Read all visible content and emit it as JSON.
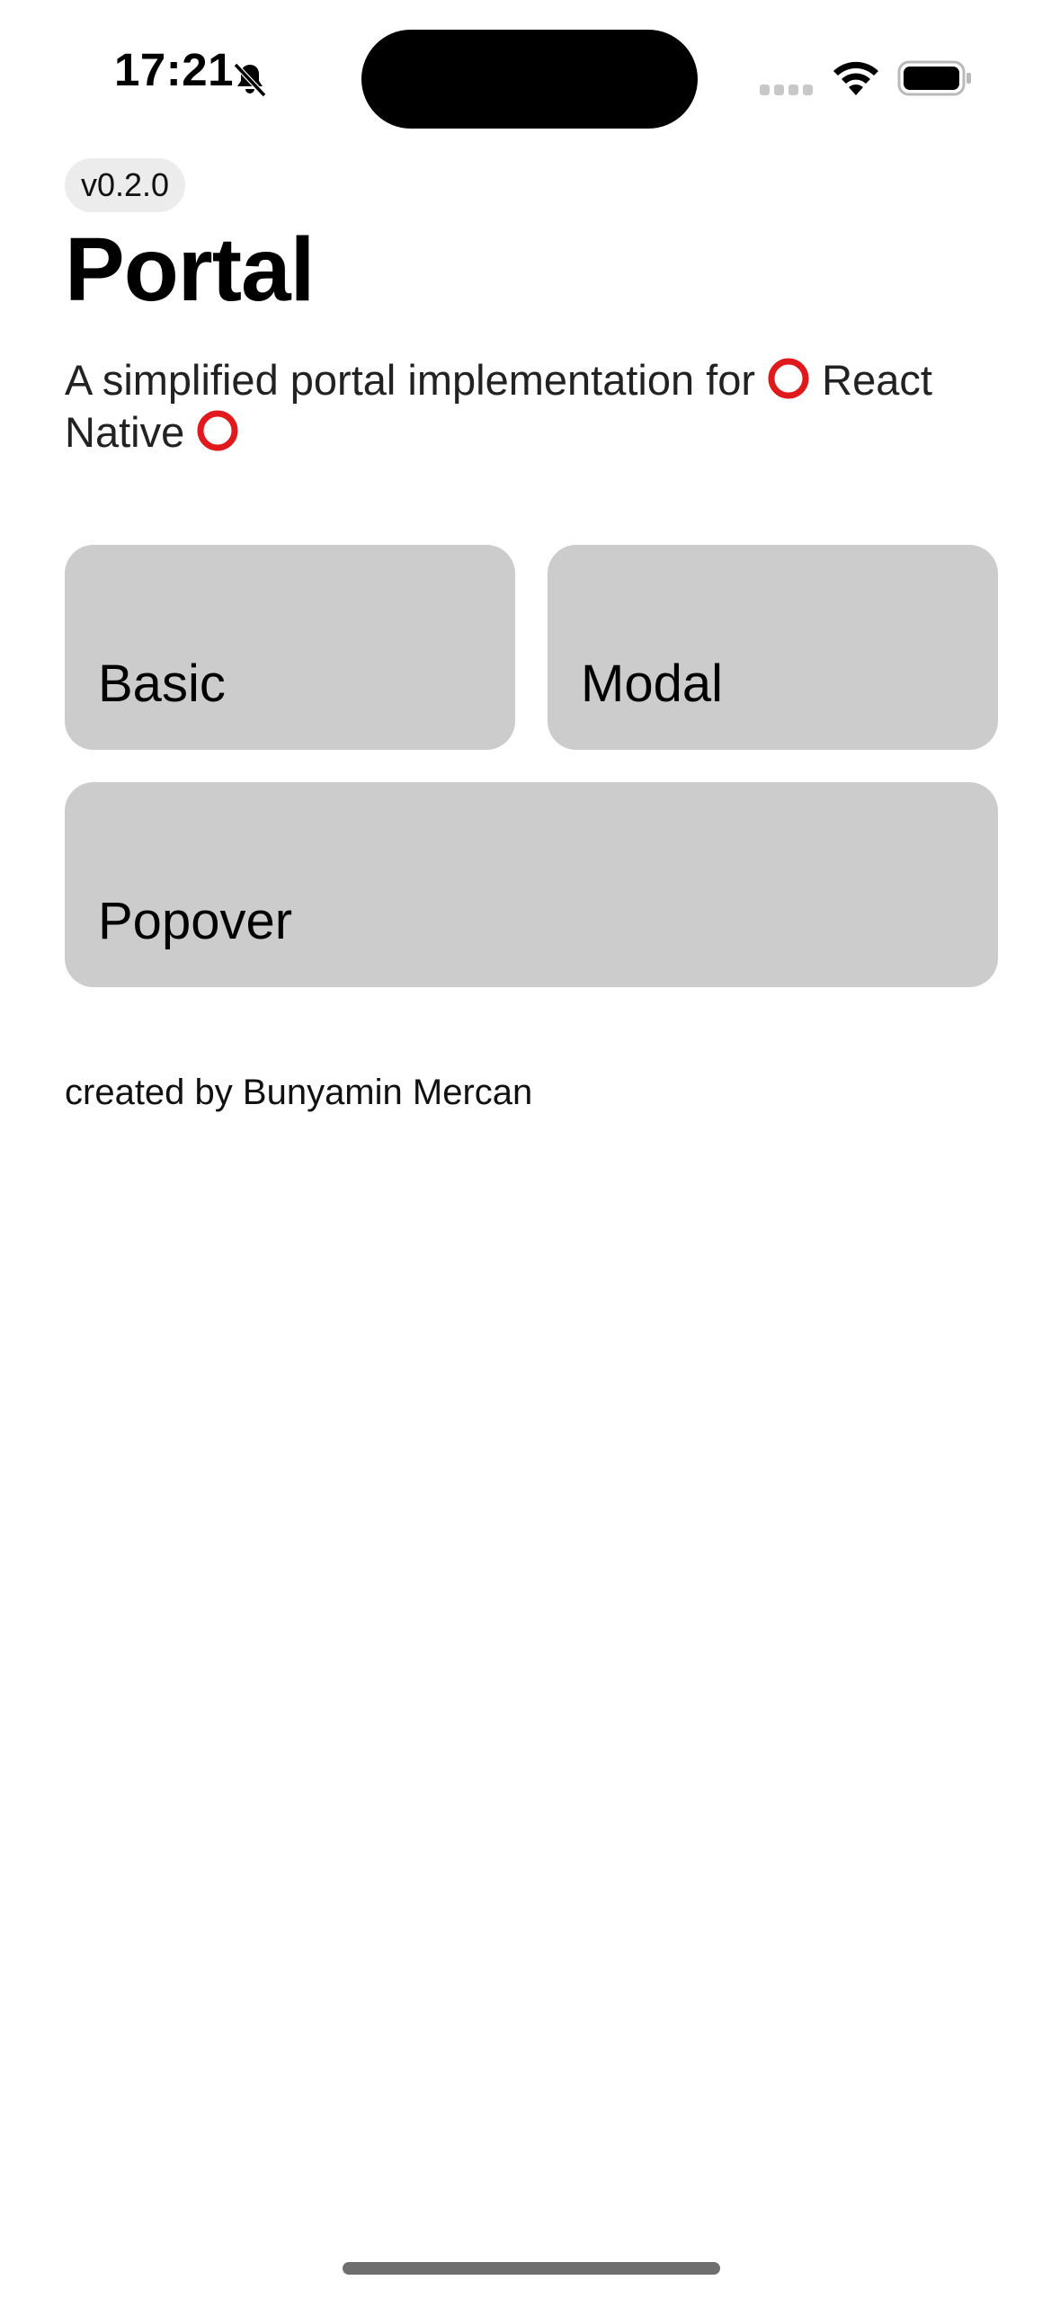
{
  "status_bar": {
    "time": "17:21",
    "icons": [
      "bell-slash-icon",
      "signal-icon",
      "wifi-icon",
      "battery-icon"
    ]
  },
  "header": {
    "version": "v0.2.0",
    "title": "Portal",
    "subtitle_part1": "A simplified portal implementation for",
    "subtitle_part2": "React",
    "subtitle_part3": "Native",
    "ring_icon": "red-circle-icon",
    "ring_color": "#e0191d"
  },
  "cards": {
    "basic": "Basic",
    "modal": "Modal",
    "popover": "Popover"
  },
  "footer": {
    "credit": "created by Bunyamin Mercan"
  },
  "colors": {
    "card_bg": "#cccccc",
    "badge_bg": "#ececec"
  }
}
